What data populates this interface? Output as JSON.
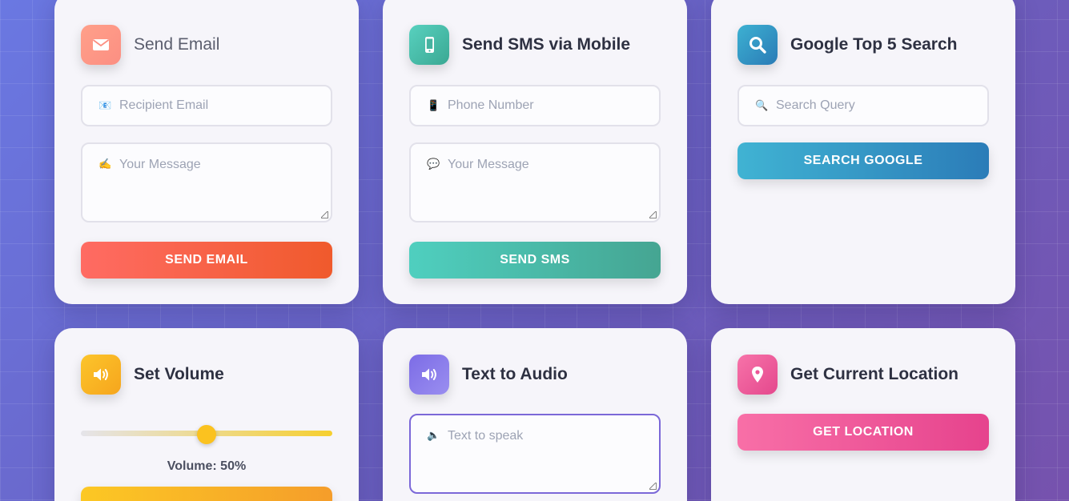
{
  "colors": {
    "email_accent": "#f05a2c",
    "sms_accent": "#45a592",
    "google_accent": "#2b7cb8",
    "volume_accent": "#fbc21f",
    "audio_accent": "#7b68d8",
    "location_accent": "#e6438d"
  },
  "email": {
    "title": "Send Email",
    "icon": "envelope-icon",
    "recipient_emoji": "📧",
    "recipient_placeholder": "Recipient Email",
    "message_emoji": "✍️",
    "message_placeholder": "Your Message",
    "button": "SEND EMAIL"
  },
  "sms": {
    "title": "Send SMS via Mobile",
    "icon": "mobile-phone-icon",
    "phone_emoji": "📱",
    "phone_placeholder": "Phone Number",
    "message_emoji": "💬",
    "message_placeholder": "Your Message",
    "button": "SEND SMS"
  },
  "google": {
    "title": "Google Top 5 Search",
    "icon": "search-icon",
    "query_emoji": "🔍",
    "query_placeholder": "Search Query",
    "button": "SEARCH GOOGLE"
  },
  "volume": {
    "title": "Set Volume",
    "icon": "speaker-icon",
    "level_fraction": 0.5,
    "label": "Volume: 50%"
  },
  "audio": {
    "title": "Text to Audio",
    "icon": "speaker-icon",
    "text_emoji": "🔈",
    "text_placeholder": "Text to speak"
  },
  "location": {
    "title": "Get Current Location",
    "icon": "map-pin-icon",
    "button": "GET LOCATION"
  }
}
